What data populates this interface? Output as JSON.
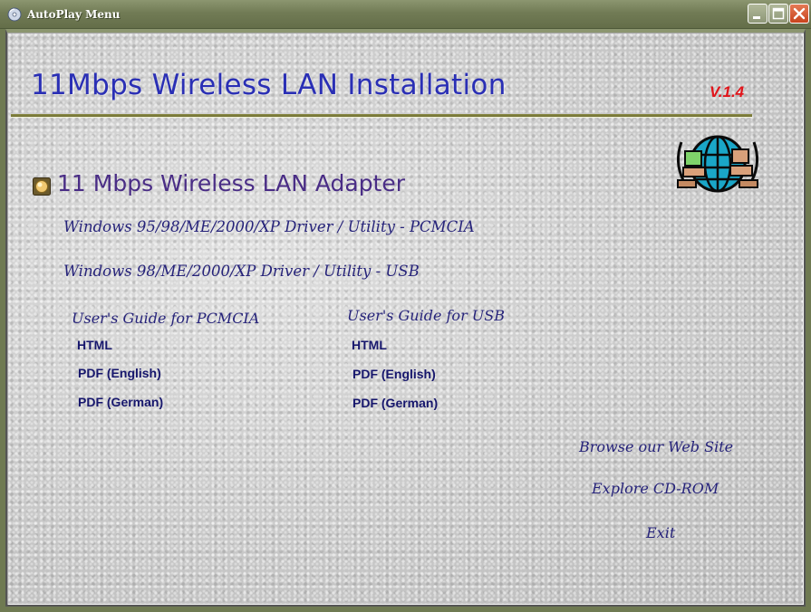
{
  "window": {
    "title": "AutoPlay Menu",
    "icon": "autoplay-cd-icon",
    "controls": {
      "minimize": "minimize-icon",
      "maximize": "maximize-icon",
      "close": "close-icon"
    }
  },
  "header": {
    "title": "11Mbps Wireless LAN Installation",
    "version": "V.1.4",
    "logo_icon": "network-globe-icon"
  },
  "section": {
    "bullet_icon": "bullet-icon",
    "title": "11 Mbps Wireless LAN Adapter",
    "driver_pcmcia": "Windows 95/98/ME/2000/XP Driver / Utility - PCMCIA",
    "driver_usb": "Windows 98/ME/2000/XP Driver / Utility  - USB"
  },
  "guides": {
    "pcmcia": {
      "heading": "User's Guide for PCMCIA",
      "html": "HTML",
      "pdf_en": "PDF (English)",
      "pdf_de": "PDF (German)"
    },
    "usb": {
      "heading": "User's Guide for USB",
      "html": "HTML",
      "pdf_en": "PDF (English)",
      "pdf_de": "PDF (German)"
    }
  },
  "actions": {
    "browse": "Browse our Web Site",
    "explore": "Explore CD-ROM",
    "exit": "Exit"
  },
  "colors": {
    "title_blue": "#2a2fb5",
    "section_purple": "#4a2d86",
    "link_navy": "#26237a",
    "version_red": "#e1141a",
    "titlebar_olive": "#717b55"
  }
}
